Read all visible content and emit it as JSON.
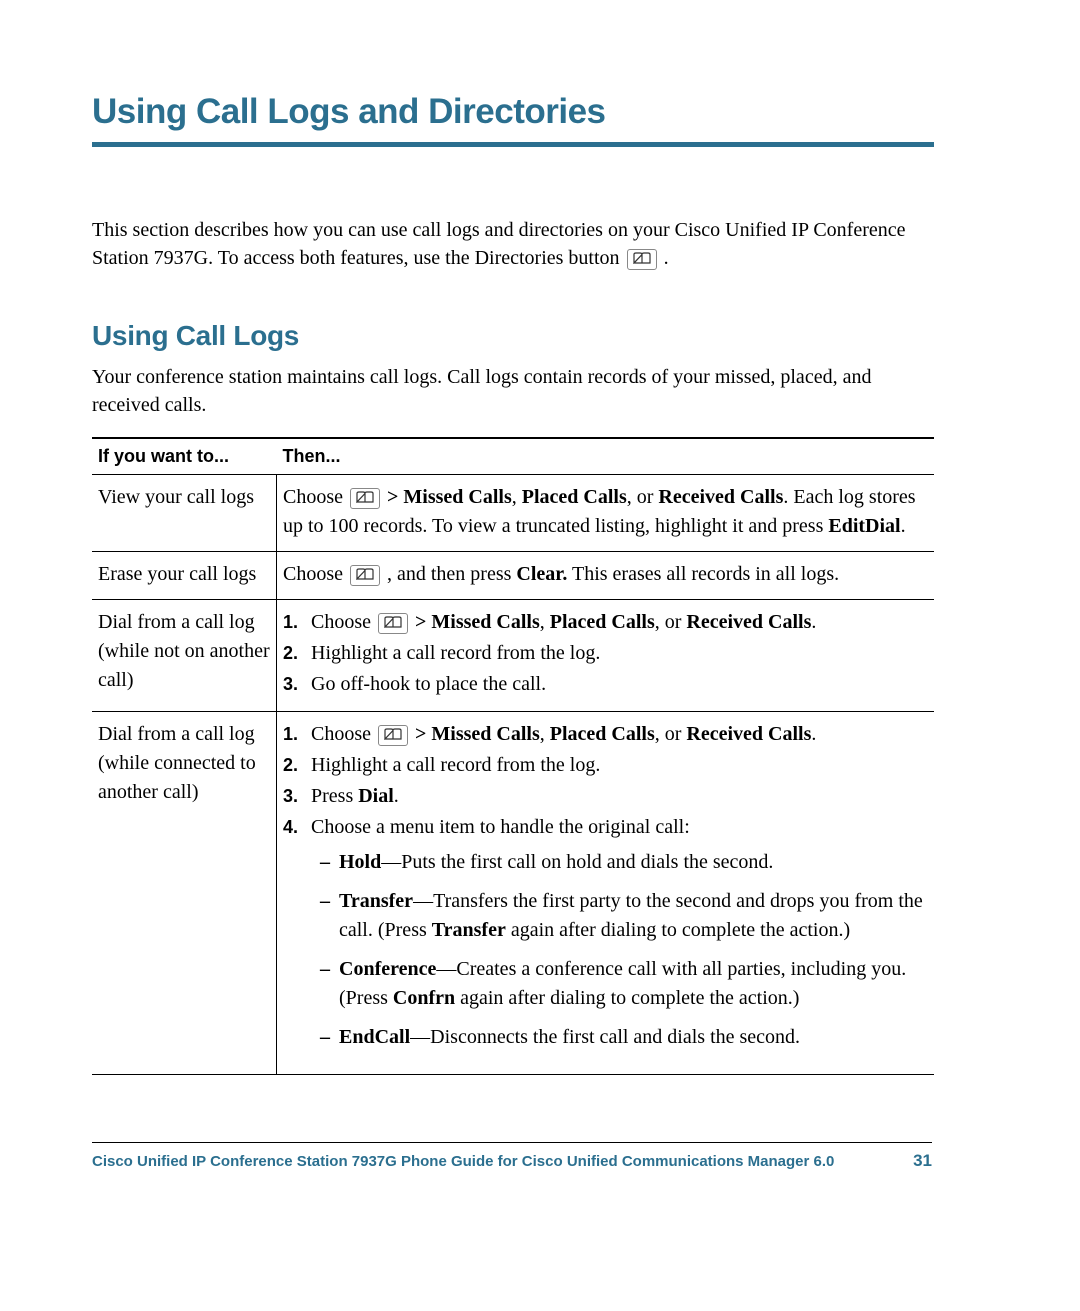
{
  "title": "Using Call Logs and Directories",
  "intro": {
    "part1": "This section describes how you can use call logs and directories on your Cisco Unified IP Conference Station 7937G. To access both features, use the Directories button ",
    "part2": "."
  },
  "subhead": "Using Call Logs",
  "subintro": "Your conference station maintains call logs. Call logs contain records of your missed, placed, and received calls.",
  "table": {
    "head_left": "If you want to...",
    "head_right": "Then...",
    "rows": [
      {
        "left": "View your call logs",
        "r1_pre": "Choose ",
        "r1_mid": " > Missed Calls",
        "r1_sep1": ", ",
        "r1_b2": "Placed Calls",
        "r1_sep2": ", or ",
        "r1_b3": "Received Calls",
        "r1_sep3": ". ",
        "r1_tail1": "Each log stores up to 100 records. To view a truncated listing, highlight it and press ",
        "r1_b4": "EditDial",
        "r1_tail2": "."
      },
      {
        "left": "Erase your call logs",
        "r2_pre": "Choose ",
        "r2_mid": ", and then press ",
        "r2_b1": "Clear.",
        "r2_tail": " This erases all records in all logs."
      },
      {
        "left": "Dial from a call log (while not on another call)",
        "s1_pre": "Choose ",
        "s1_mid": " > Missed Calls",
        "s1_sep1": ", ",
        "s1_b2": "Placed Calls",
        "s1_sep2": ", or ",
        "s1_b3": "Received Calls",
        "s1_sep3": ".",
        "s2": "Highlight a call record from the log.",
        "s3": "Go off-hook to place the call."
      },
      {
        "left": "Dial from a call log (while connected to another call)",
        "t1_pre": "Choose ",
        "t1_mid": " > Missed Calls",
        "t1_sep1": ", ",
        "t1_b2": "Placed Calls",
        "t1_sep2": ", or ",
        "t1_b3": "Received Calls",
        "t1_sep3": ".",
        "t2": "Highlight a call record from the log.",
        "t3_pre": "Press ",
        "t3_b1": "Dial",
        "t3_post": ".",
        "t4": "Choose a menu item to handle the original call:",
        "d1_b": "Hold",
        "d1_t": "—Puts the first call on hold and dials the second.",
        "d2_b": "Transfer",
        "d2_t1": "—Transfers the first party to the second and drops you from the call. (Press ",
        "d2_b2": "Transfer",
        "d2_t2": " again after dialing to complete the action.)",
        "d3_b": "Conference",
        "d3_t1": "—Creates a conference call with all parties, including you. (Press ",
        "d3_b2": "Confrn",
        "d3_t2": " again after dialing to complete the action.)",
        "d4_b": "EndCall",
        "d4_t": "—Disconnects the first call and dials the second."
      }
    ],
    "num1": "1.",
    "num2": "2.",
    "num3": "3.",
    "num4": "4.",
    "dash": "–"
  },
  "footer": {
    "title": "Cisco Unified IP Conference Station 7937G Phone Guide for Cisco Unified Communications Manager 6.0",
    "page": "31"
  }
}
